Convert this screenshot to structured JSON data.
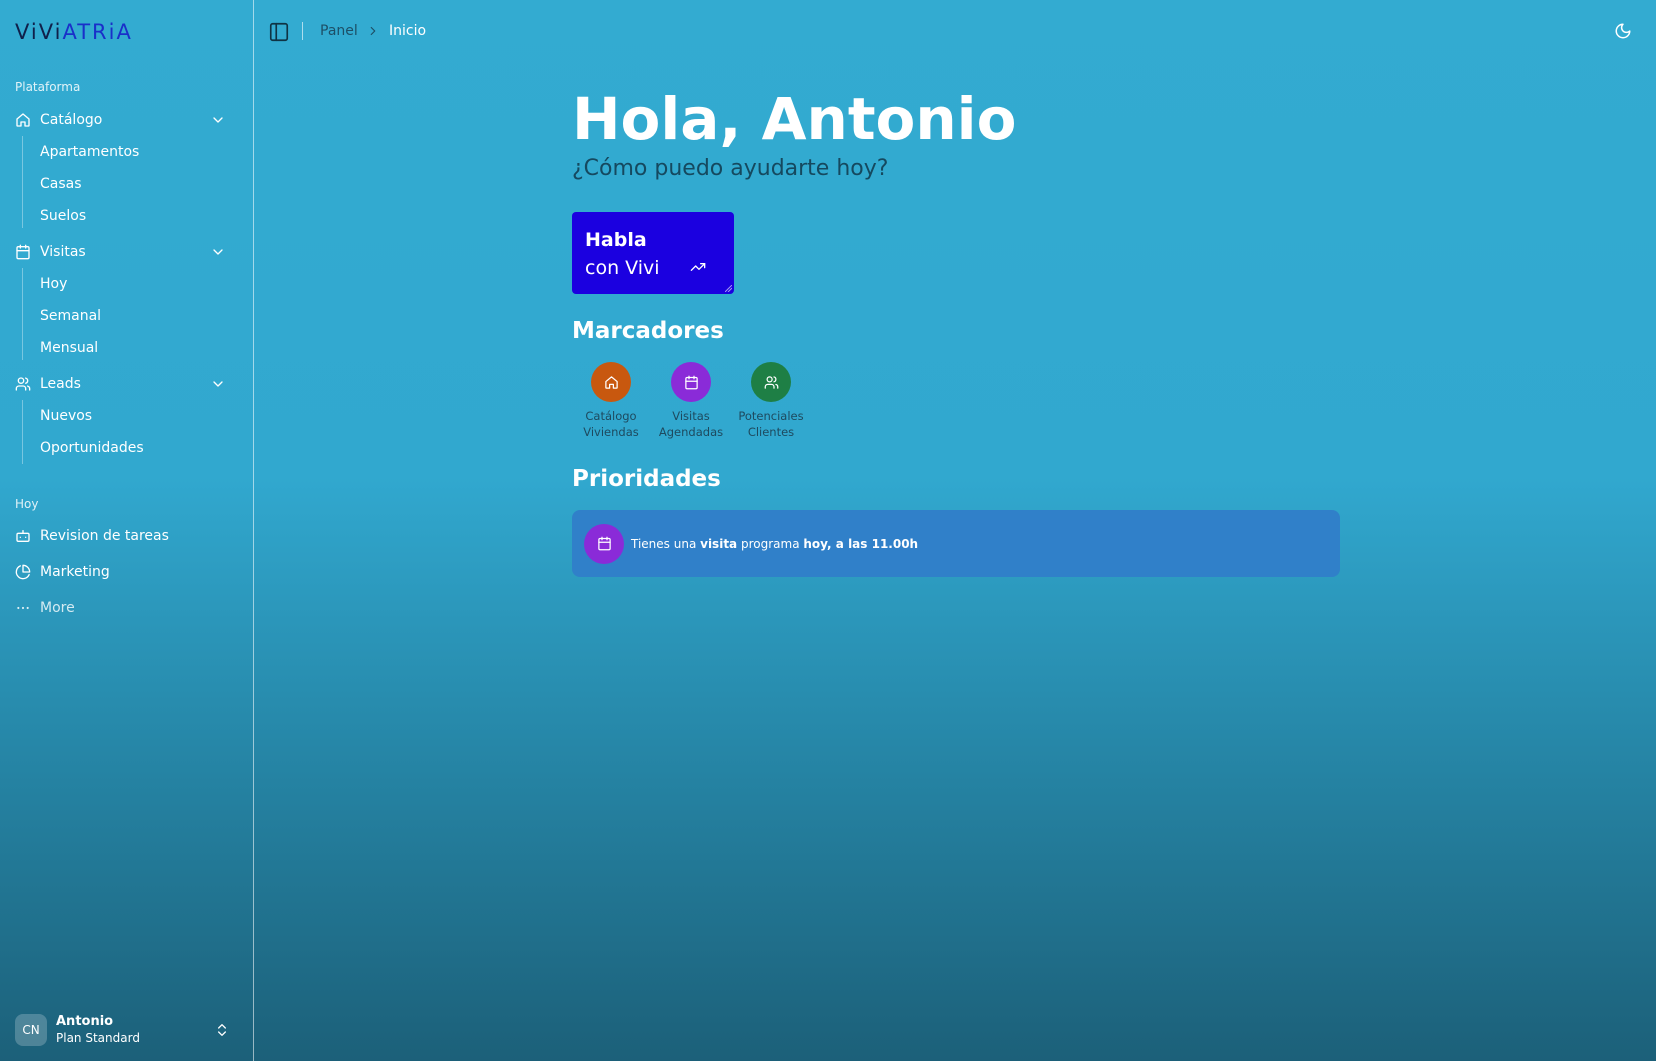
{
  "app": {
    "logo_part1": "ViVi",
    "logo_part2": "ATRiA"
  },
  "sidebar": {
    "section_platform": "Plataforma",
    "catalog": {
      "label": "Catálogo",
      "items": [
        "Apartamentos",
        "Casas",
        "Suelos"
      ]
    },
    "visits": {
      "label": "Visitas",
      "items": [
        "Hoy",
        "Semanal",
        "Mensual"
      ]
    },
    "leads": {
      "label": "Leads",
      "items": [
        "Nuevos",
        "Oportunidades"
      ]
    },
    "section_today": "Hoy",
    "today_items": [
      "Revision de tareas",
      "Marketing"
    ],
    "more": "More",
    "user": {
      "initials": "CN",
      "name": "Antonio",
      "plan": "Plan Standard"
    }
  },
  "topbar": {
    "breadcrumb_parent": "Panel",
    "breadcrumb_current": "Inicio"
  },
  "main": {
    "greeting_prefix": "Hola, ",
    "greeting_name": "Antonio",
    "subtitle": "¿Cómo puedo ayudarte hoy?",
    "cta_line1": "Habla",
    "cta_line2": "con Vivi",
    "bookmarks_title": "Marcadores",
    "bookmarks": [
      {
        "line1": "Catálogo",
        "line2": "Viviendas",
        "color": "#c8580f",
        "icon": "home-icon"
      },
      {
        "line1": "Visitas",
        "line2": "Agendadas",
        "color": "#8a2bd8",
        "icon": "calendar-icon"
      },
      {
        "line1": "Potenciales",
        "line2": "Clientes",
        "color": "#1e7f45",
        "icon": "users-icon"
      }
    ],
    "priorities_title": "Prioridades",
    "priority": {
      "t1": "Tienes una ",
      "t2": "visita",
      "t3": " programa ",
      "t4": "hoy, a las 11.00h",
      "icon_color": "#8a2bd8"
    }
  },
  "colors": {
    "cta_background": "#1b00e0",
    "priority_background": "#3080c9"
  }
}
